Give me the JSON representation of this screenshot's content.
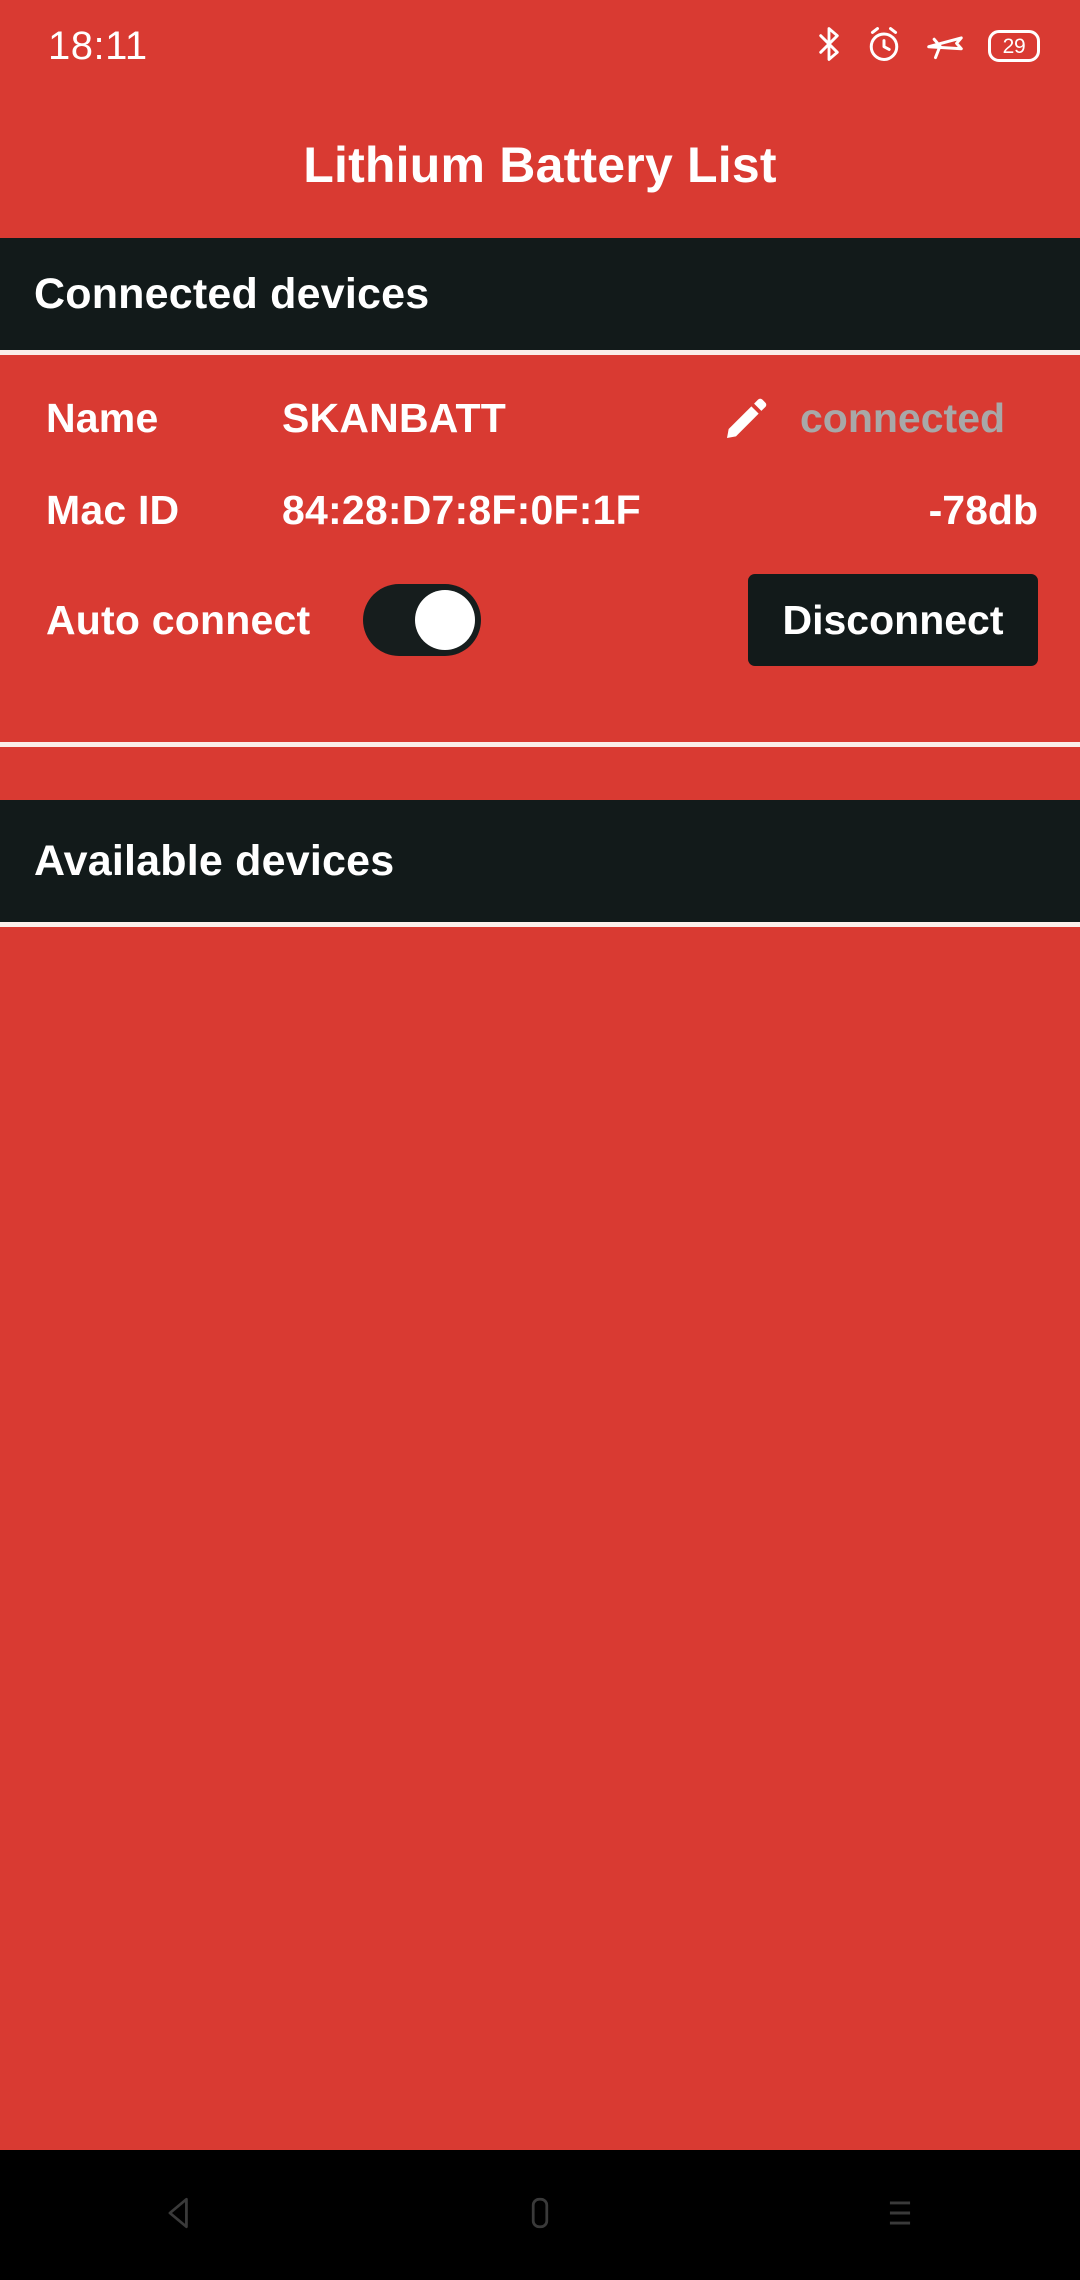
{
  "status_bar": {
    "time": "18:11",
    "icons": [
      {
        "name": "bluetooth-icon"
      },
      {
        "name": "alarm-icon"
      },
      {
        "name": "airplane-mode-icon"
      }
    ],
    "battery_level": "29"
  },
  "app_bar": {
    "title": "Lithium Battery List"
  },
  "connected_section": {
    "header": "Connected devices",
    "device": {
      "name_label": "Name",
      "name_value": "SKANBATT",
      "edit_icon": "pencil-icon",
      "status": "connected",
      "status_color": "#A8A8A8",
      "mac_label": "Mac ID",
      "mac_value": "84:28:D7:8F:0F:1F",
      "signal_strength": "-78db",
      "auto_connect_label": "Auto connect",
      "auto_connect_on": true,
      "disconnect_label": "Disconnect"
    }
  },
  "available_section": {
    "header": "Available devices",
    "devices": []
  },
  "nav_bar": {
    "back": "back-icon",
    "home": "home-icon",
    "recents": "recents-icon"
  },
  "colors": {
    "accent_red": "#D93A32",
    "dark_bar": "#121A1A",
    "divider": "#FBEDE9",
    "white": "#FFFFFF",
    "nav_bg": "#000000"
  }
}
